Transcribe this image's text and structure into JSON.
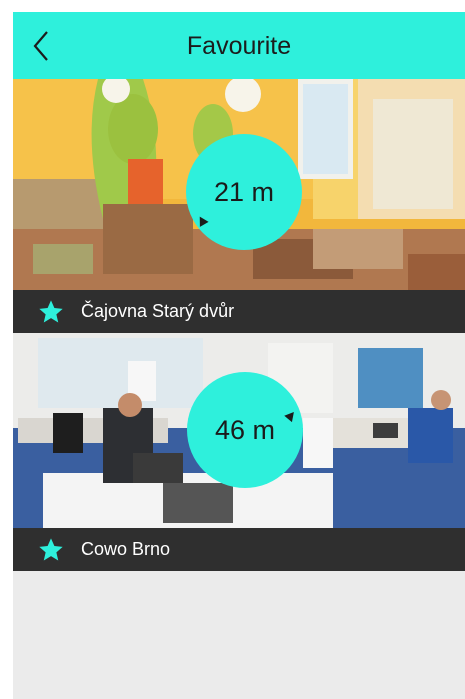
{
  "header": {
    "title": "Favourite"
  },
  "favourites": [
    {
      "name": "Čajovna Starý dvůr",
      "distance": "21 m"
    },
    {
      "name": "Cowo Brno",
      "distance": "46 m"
    }
  ],
  "colors": {
    "accent": "#2ef0dc",
    "caption_bg": "#2f2f2f",
    "screen_bg": "#ebebeb"
  },
  "icons": {
    "back": "chevron-left-icon",
    "favourite": "star-icon",
    "direction": "direction-arrow-icon"
  }
}
